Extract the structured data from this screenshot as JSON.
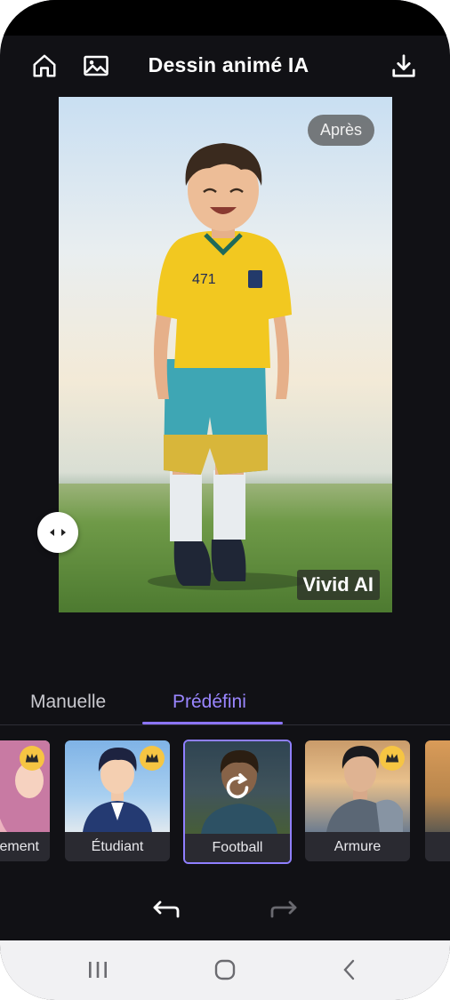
{
  "header": {
    "title": "Dessin animé IA",
    "icons": [
      "home-icon",
      "gallery-icon",
      "download-icon"
    ]
  },
  "preview": {
    "after_badge": "Après",
    "watermark": "Vivid AI",
    "compare_handle_icon": "compare-arrows-icon"
  },
  "tabs": [
    {
      "label": "Manuelle",
      "active": false
    },
    {
      "label": "Prédéfini",
      "active": true
    }
  ],
  "styles": [
    {
      "label": "ement",
      "premium": true,
      "selected": false
    },
    {
      "label": "Étudiant",
      "premium": true,
      "selected": false
    },
    {
      "label": "Football",
      "premium": false,
      "selected": true
    },
    {
      "label": "Armure",
      "premium": true,
      "selected": false
    },
    {
      "label": "",
      "premium": false,
      "selected": false
    }
  ],
  "actions": {
    "undo_icon": "undo-icon",
    "redo_icon": "redo-icon"
  },
  "system_nav": [
    "recents-icon",
    "home-circle-icon",
    "back-icon"
  ],
  "colors": {
    "background": "#111115",
    "accent": "#8c75ff",
    "crown": "#f6c543"
  }
}
